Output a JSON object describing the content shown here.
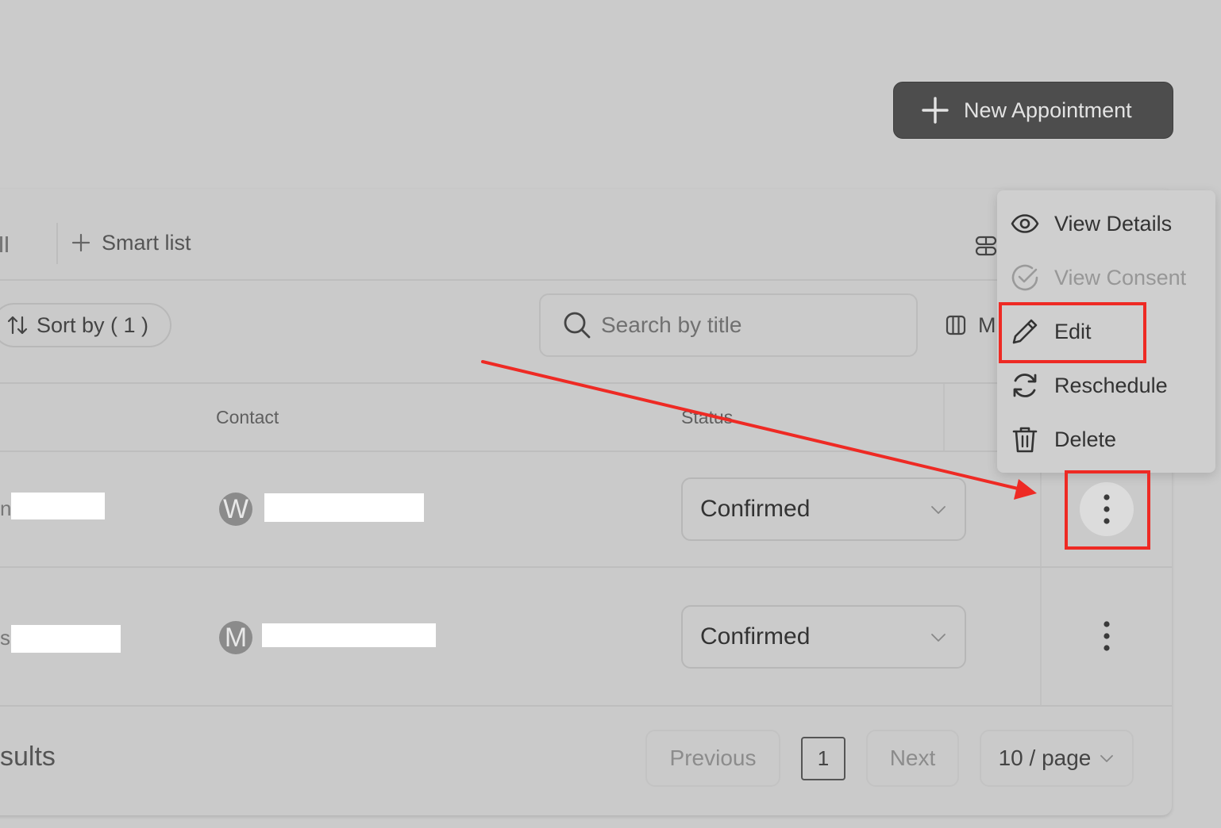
{
  "header": {
    "new_appointment_label": "New Appointment"
  },
  "toolbar": {
    "smart_list_label": "Smart list",
    "sort_label": "Sort by ( 1 )",
    "search_placeholder": "Search by title",
    "columns_label_fragment": "M"
  },
  "table": {
    "columns": {
      "contact": "Contact",
      "status": "Status"
    },
    "rows": [
      {
        "title_fragment": "n",
        "avatar_initial": "W",
        "status": "Confirmed"
      },
      {
        "title_fragment": "s",
        "avatar_initial": "M",
        "status": "Confirmed"
      }
    ]
  },
  "footer": {
    "results_fragment": "sults",
    "previous_label": "Previous",
    "current_page": "1",
    "next_label": "Next",
    "per_page_label": "10 / page"
  },
  "context_menu": {
    "items": [
      {
        "label": "View Details",
        "icon": "eye-icon",
        "disabled": false
      },
      {
        "label": "View Consent",
        "icon": "check-circle-icon",
        "disabled": true
      },
      {
        "label": "Edit",
        "icon": "pencil-icon",
        "disabled": false
      },
      {
        "label": "Reschedule",
        "icon": "refresh-icon",
        "disabled": false
      },
      {
        "label": "Delete",
        "icon": "trash-icon",
        "disabled": false
      }
    ]
  },
  "annotations": {
    "highlight_color": "#ee2a24"
  }
}
